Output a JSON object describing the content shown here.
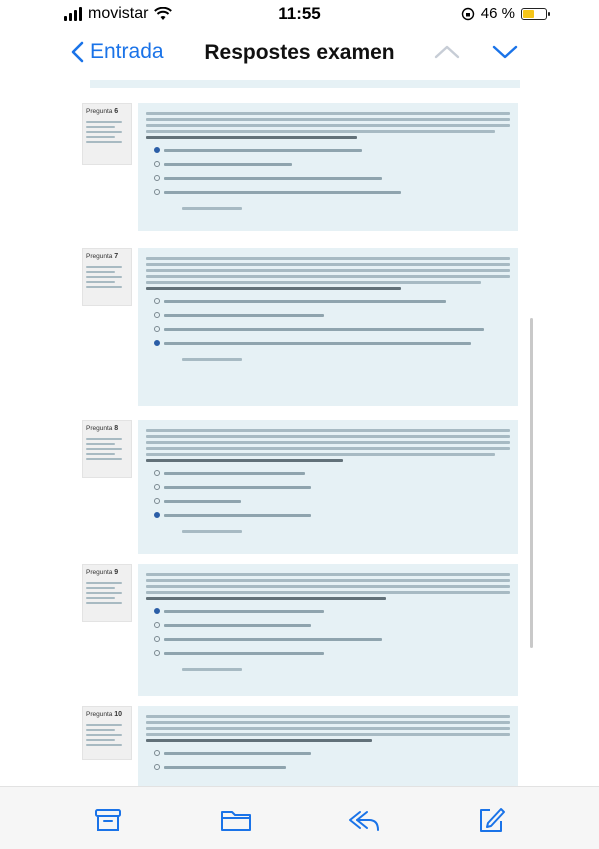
{
  "status_bar": {
    "carrier": "movistar",
    "time": "11:55",
    "battery_percent": "46 %",
    "battery_level": 0.46
  },
  "nav": {
    "back_label": "Entrada",
    "title": "Respostes examen",
    "up_icon": "chevron-up-icon",
    "down_icon": "chevron-down-icon"
  },
  "questions": [
    {
      "number": "6",
      "selected_option": 0,
      "option_count": 4
    },
    {
      "number": "7",
      "selected_option": 3,
      "option_count": 4
    },
    {
      "number": "8",
      "selected_option": 3,
      "option_count": 4
    },
    {
      "number": "9",
      "selected_option": 0,
      "option_count": 4
    },
    {
      "number": "10",
      "selected_option": null,
      "option_count": 2
    }
  ],
  "question_label": "Pregunta",
  "tab_bar": {
    "icons": [
      "archive-icon",
      "folder-icon",
      "reply-icon",
      "compose-icon"
    ],
    "accent": "#1a73e8"
  }
}
